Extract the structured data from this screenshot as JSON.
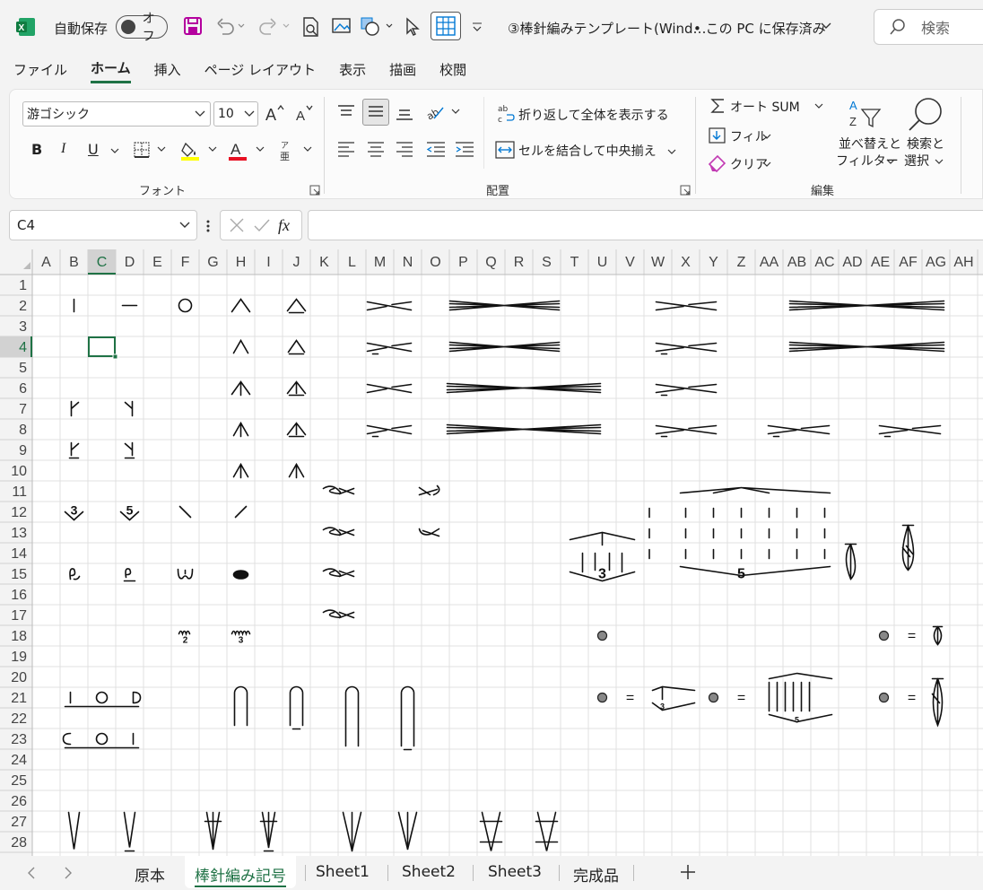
{
  "titlebar": {
    "autosave_label": "自動保存",
    "autosave_state": "オフ",
    "doc_title": "③棒針編みテンプレート(Wind…",
    "save_status": "• この PC に保存済み",
    "search_placeholder": "検索"
  },
  "menu": [
    "ファイル",
    "ホーム",
    "挿入",
    "ページ レイアウト",
    "表示",
    "描画",
    "校閲"
  ],
  "font_group": {
    "font_name": "游ゴシック",
    "font_size": "10",
    "bold": "B",
    "italic": "I",
    "underline": "U",
    "label": "フォント",
    "grow": "A",
    "phonetic": "ア亜"
  },
  "align_group": {
    "wrap_text": "折り返して全体を表示する",
    "merge_center": "セルを結合して中央揃え",
    "label": "配置"
  },
  "edit_group": {
    "autosum": "オート SUM",
    "fill": "フィル",
    "clear": "クリア",
    "sort_filter": "並べ替えと",
    "sort_filter2": "フィルター",
    "find_select": "検索と",
    "find_select2": "選択",
    "label": "編集"
  },
  "formula_bar": {
    "name_box": "C4",
    "fx": "fx",
    "formula": ""
  },
  "grid": {
    "columns": [
      "A",
      "B",
      "C",
      "D",
      "E",
      "F",
      "G",
      "H",
      "I",
      "J",
      "K",
      "L",
      "M",
      "N",
      "O",
      "P",
      "Q",
      "R",
      "S",
      "T",
      "U",
      "V",
      "W",
      "X",
      "Y",
      "Z",
      "AA",
      "AB",
      "AC",
      "AD",
      "AE",
      "AF",
      "AG",
      "AH"
    ],
    "rows": [
      "1",
      "2",
      "3",
      "4",
      "5",
      "6",
      "7",
      "8",
      "9",
      "10",
      "11",
      "12",
      "13",
      "14",
      "15",
      "16",
      "17",
      "18",
      "19",
      "20",
      "21",
      "22",
      "23",
      "24",
      "25",
      "26",
      "27",
      "28"
    ],
    "selected_cell": "C4",
    "cell_labels": {
      "cluster3": "3",
      "cluster5": "5",
      "dec3": "3",
      "dec5": "5",
      "loop2": "2",
      "loop3": "3",
      "eq": "="
    }
  },
  "sheet_tabs": [
    "原本",
    "棒針編み記号",
    "Sheet1",
    "Sheet2",
    "Sheet3",
    "完成品"
  ],
  "active_tab": "棒針編み記号",
  "colors": {
    "excel_green": "#1f7245",
    "grid_line": "#e1e1e1",
    "header_bg": "#f3f3f3",
    "highlight_yellow": "#ffff00",
    "font_red": "#e81123"
  }
}
